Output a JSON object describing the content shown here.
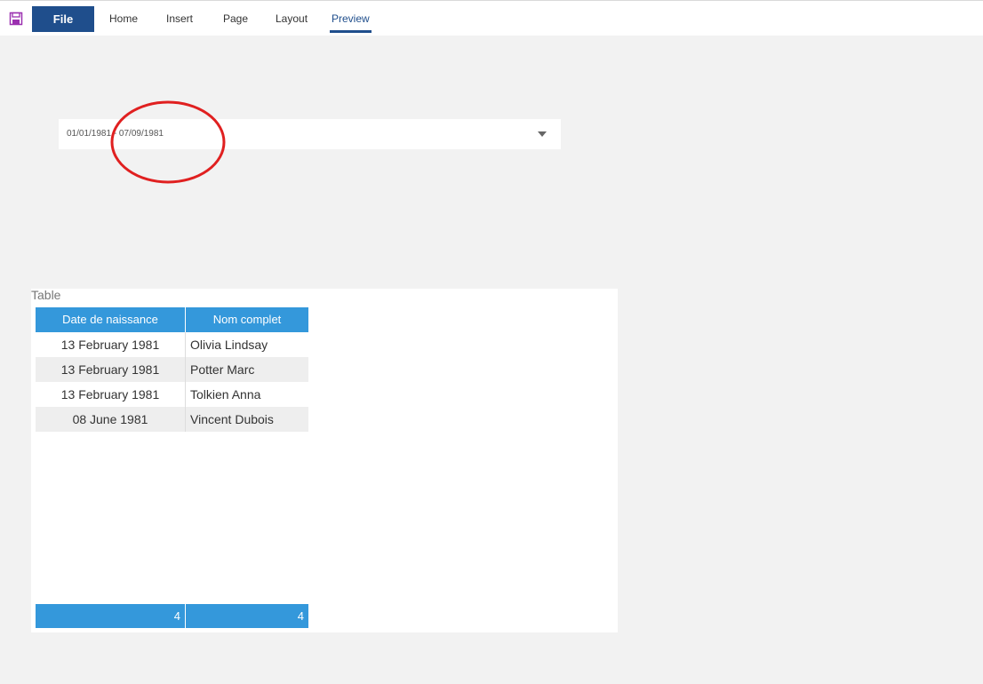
{
  "ribbon": {
    "file_label": "File",
    "tabs": [
      {
        "label": "Home"
      },
      {
        "label": "Insert"
      },
      {
        "label": "Page"
      },
      {
        "label": "Layout"
      },
      {
        "label": "Preview",
        "active": true
      }
    ]
  },
  "date_filter": {
    "value": "01/01/1981 - 07/09/1981"
  },
  "table": {
    "title": "Table",
    "columns": [
      "Date de naissance",
      "Nom complet"
    ],
    "rows": [
      [
        "13 February 1981",
        "Olivia Lindsay"
      ],
      [
        "13 February 1981",
        "Potter Marc"
      ],
      [
        "13 February 1981",
        "Tolkien Anna"
      ],
      [
        "08 June 1981",
        "Vincent Dubois"
      ]
    ],
    "totals": [
      "4",
      "4"
    ]
  },
  "colors": {
    "accent": "#1f4e8c",
    "header": "#3498db",
    "annotation": "#e02020"
  }
}
